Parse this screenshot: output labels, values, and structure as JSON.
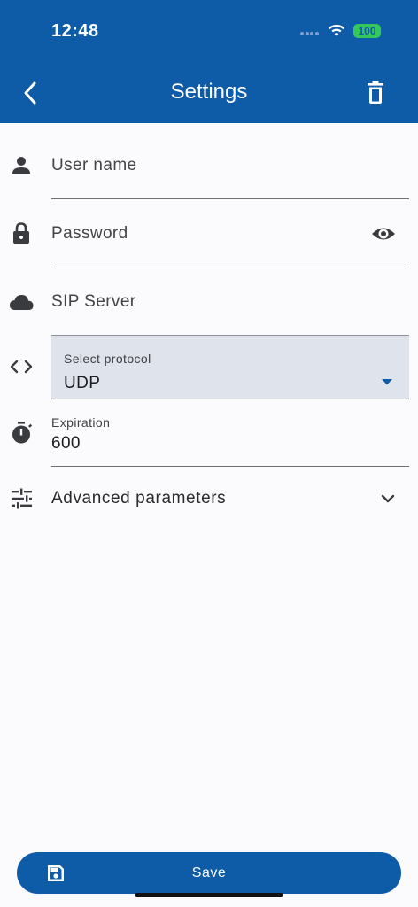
{
  "status_bar": {
    "time": "12:48",
    "battery": "100"
  },
  "header": {
    "title": "Settings"
  },
  "form": {
    "username": {
      "placeholder": "User name",
      "value": ""
    },
    "password": {
      "placeholder": "Password",
      "value": ""
    },
    "sip_server": {
      "placeholder": "SIP Server",
      "value": ""
    },
    "protocol": {
      "label": "Select protocol",
      "value": "UDP"
    },
    "expiration": {
      "label": "Expiration",
      "value": "600"
    },
    "advanced": {
      "label": "Advanced parameters"
    }
  },
  "footer": {
    "save_label": "Save"
  },
  "colors": {
    "primary": "#0e5ba7",
    "battery": "#34c759",
    "background": "#fbfbfe",
    "select_fill": "#dfe3ec"
  },
  "icons": [
    "back-arrow-icon",
    "trash-icon",
    "person-icon",
    "lock-icon",
    "eye-icon",
    "cloud-icon",
    "code-icon",
    "timer-icon",
    "tune-icon",
    "chevron-down-icon",
    "caret-down-icon",
    "save-icon",
    "wifi-icon"
  ]
}
